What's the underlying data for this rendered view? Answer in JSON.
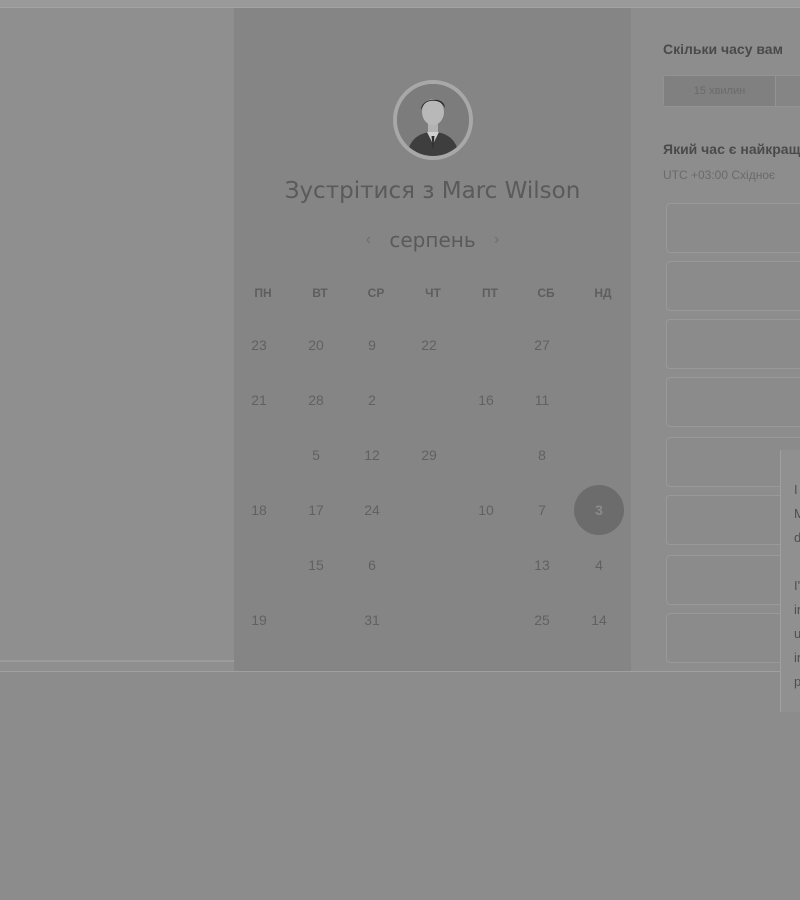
{
  "booking": {
    "title": "Зустрітися з Marc Wilson",
    "month": "серпень",
    "prev_icon": "‹",
    "next_icon": "›",
    "weekdays": [
      "ПН",
      "ВТ",
      "СР",
      "ЧТ",
      "ПТ",
      "СБ",
      "НД"
    ],
    "weeks": [
      [
        "23",
        "20",
        "9",
        "22",
        "",
        "27",
        ""
      ],
      [
        "21",
        "28",
        "2",
        "",
        "16",
        "11",
        ""
      ],
      [
        "",
        "5",
        "12",
        "29",
        "",
        "8",
        ""
      ],
      [
        "18",
        "17",
        "24",
        "",
        "10",
        "7",
        "3"
      ],
      [
        "",
        "15",
        "6",
        "",
        "",
        "13",
        "4"
      ],
      [
        "19",
        "",
        "31",
        "",
        "",
        "25",
        "14"
      ]
    ],
    "selected_day": "3"
  },
  "scheduling": {
    "duration_question": "Скільки часу вам",
    "duration_selected": "15 хвилин",
    "time_question": "Який час є найкращ",
    "timezone": "UTC +03:00 Східноє"
  },
  "tooltip": {
    "lines": [
      "I",
      "M",
      "d",
      "I'",
      "in",
      "u",
      "in",
      "p"
    ]
  }
}
